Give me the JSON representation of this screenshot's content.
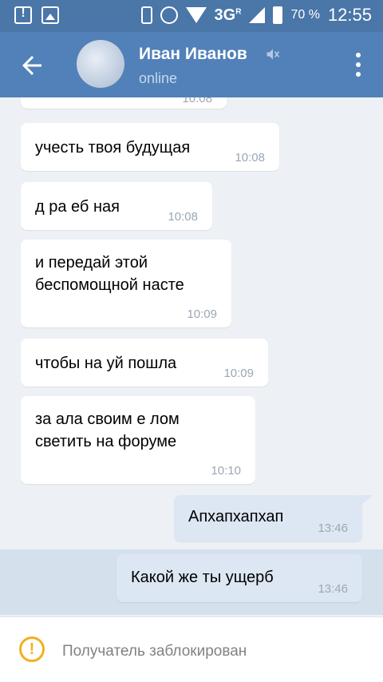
{
  "status_bar": {
    "network": "3G",
    "network_sup": "R",
    "battery": "70 %",
    "time": "12:55"
  },
  "header": {
    "contact_name": "Иван Иванов",
    "status": "online",
    "icons": [
      "back-arrow-icon",
      "mute-icon",
      "more-vert-icon"
    ]
  },
  "messages": [
    {
      "dir": "in",
      "lines": [
        "учесть твоя будущая"
      ],
      "time": "10:08"
    },
    {
      "dir": "in",
      "lines": [
        "д ра еб ная"
      ],
      "time": "10:08"
    },
    {
      "dir": "in",
      "lines": [
        "и передай этой",
        "беспомощной насте"
      ],
      "time": "10:09"
    },
    {
      "dir": "in",
      "lines": [
        "чтобы на уй пошла"
      ],
      "time": "10:09"
    },
    {
      "dir": "in",
      "lines": [
        "за ала своим е лом",
        "светить на форуме"
      ],
      "time": "10:10"
    },
    {
      "dir": "out",
      "lines": [
        "Апхапхапхап"
      ],
      "time": "13:46"
    },
    {
      "dir": "out",
      "lines": [
        "Какой же ты ущерб"
      ],
      "time": "13:46"
    }
  ],
  "partial_top_message": {
    "time": "10:08"
  },
  "footer": {
    "text": "Получатель заблокирован",
    "icon": "warning-icon",
    "accent": "#f2b01e"
  },
  "colors": {
    "header": "#5181b8",
    "status_bar": "#4a76a8",
    "background": "#edf1f5",
    "outgoing_bubble": "#dde7f3"
  }
}
